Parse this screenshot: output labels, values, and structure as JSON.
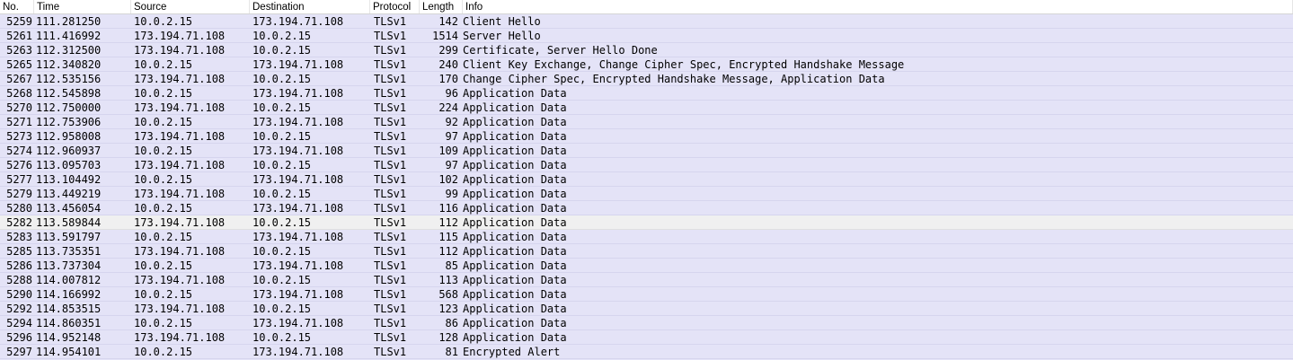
{
  "columns": {
    "no": "No.",
    "time": "Time",
    "source": "Source",
    "destination": "Destination",
    "protocol": "Protocol",
    "length": "Length",
    "info": "Info"
  },
  "packets": [
    {
      "no": "5259",
      "time": "111.281250",
      "source": "10.0.2.15",
      "destination": "173.194.71.108",
      "protocol": "TLSv1",
      "length": "142",
      "info": "Client Hello"
    },
    {
      "no": "5261",
      "time": "111.416992",
      "source": "173.194.71.108",
      "destination": "10.0.2.15",
      "protocol": "TLSv1",
      "length": "1514",
      "info": "Server Hello"
    },
    {
      "no": "5263",
      "time": "112.312500",
      "source": "173.194.71.108",
      "destination": "10.0.2.15",
      "protocol": "TLSv1",
      "length": "299",
      "info": "Certificate, Server Hello Done"
    },
    {
      "no": "5265",
      "time": "112.340820",
      "source": "10.0.2.15",
      "destination": "173.194.71.108",
      "protocol": "TLSv1",
      "length": "240",
      "info": "Client Key Exchange, Change Cipher Spec, Encrypted Handshake Message"
    },
    {
      "no": "5267",
      "time": "112.535156",
      "source": "173.194.71.108",
      "destination": "10.0.2.15",
      "protocol": "TLSv1",
      "length": "170",
      "info": "Change Cipher Spec, Encrypted Handshake Message, Application Data"
    },
    {
      "no": "5268",
      "time": "112.545898",
      "source": "10.0.2.15",
      "destination": "173.194.71.108",
      "protocol": "TLSv1",
      "length": "96",
      "info": "Application Data"
    },
    {
      "no": "5270",
      "time": "112.750000",
      "source": "173.194.71.108",
      "destination": "10.0.2.15",
      "protocol": "TLSv1",
      "length": "224",
      "info": "Application Data"
    },
    {
      "no": "5271",
      "time": "112.753906",
      "source": "10.0.2.15",
      "destination": "173.194.71.108",
      "protocol": "TLSv1",
      "length": "92",
      "info": "Application Data"
    },
    {
      "no": "5273",
      "time": "112.958008",
      "source": "173.194.71.108",
      "destination": "10.0.2.15",
      "protocol": "TLSv1",
      "length": "97",
      "info": "Application Data"
    },
    {
      "no": "5274",
      "time": "112.960937",
      "source": "10.0.2.15",
      "destination": "173.194.71.108",
      "protocol": "TLSv1",
      "length": "109",
      "info": "Application Data"
    },
    {
      "no": "5276",
      "time": "113.095703",
      "source": "173.194.71.108",
      "destination": "10.0.2.15",
      "protocol": "TLSv1",
      "length": "97",
      "info": "Application Data"
    },
    {
      "no": "5277",
      "time": "113.104492",
      "source": "10.0.2.15",
      "destination": "173.194.71.108",
      "protocol": "TLSv1",
      "length": "102",
      "info": "Application Data"
    },
    {
      "no": "5279",
      "time": "113.449219",
      "source": "173.194.71.108",
      "destination": "10.0.2.15",
      "protocol": "TLSv1",
      "length": "99",
      "info": "Application Data"
    },
    {
      "no": "5280",
      "time": "113.456054",
      "source": "10.0.2.15",
      "destination": "173.194.71.108",
      "protocol": "TLSv1",
      "length": "116",
      "info": "Application Data"
    },
    {
      "no": "5282",
      "time": "113.589844",
      "source": "173.194.71.108",
      "destination": "10.0.2.15",
      "protocol": "TLSv1",
      "length": "112",
      "info": "Application Data",
      "highlight": true
    },
    {
      "no": "5283",
      "time": "113.591797",
      "source": "10.0.2.15",
      "destination": "173.194.71.108",
      "protocol": "TLSv1",
      "length": "115",
      "info": "Application Data"
    },
    {
      "no": "5285",
      "time": "113.735351",
      "source": "173.194.71.108",
      "destination": "10.0.2.15",
      "protocol": "TLSv1",
      "length": "112",
      "info": "Application Data"
    },
    {
      "no": "5286",
      "time": "113.737304",
      "source": "10.0.2.15",
      "destination": "173.194.71.108",
      "protocol": "TLSv1",
      "length": "85",
      "info": "Application Data"
    },
    {
      "no": "5288",
      "time": "114.007812",
      "source": "173.194.71.108",
      "destination": "10.0.2.15",
      "protocol": "TLSv1",
      "length": "113",
      "info": "Application Data"
    },
    {
      "no": "5290",
      "time": "114.166992",
      "source": "10.0.2.15",
      "destination": "173.194.71.108",
      "protocol": "TLSv1",
      "length": "568",
      "info": "Application Data"
    },
    {
      "no": "5292",
      "time": "114.853515",
      "source": "173.194.71.108",
      "destination": "10.0.2.15",
      "protocol": "TLSv1",
      "length": "123",
      "info": "Application Data"
    },
    {
      "no": "5294",
      "time": "114.860351",
      "source": "10.0.2.15",
      "destination": "173.194.71.108",
      "protocol": "TLSv1",
      "length": "86",
      "info": "Application Data"
    },
    {
      "no": "5296",
      "time": "114.952148",
      "source": "173.194.71.108",
      "destination": "10.0.2.15",
      "protocol": "TLSv1",
      "length": "128",
      "info": "Application Data"
    },
    {
      "no": "5297",
      "time": "114.954101",
      "source": "10.0.2.15",
      "destination": "173.194.71.108",
      "protocol": "TLSv1",
      "length": "81",
      "info": "Encrypted Alert"
    }
  ],
  "colors": {
    "row_background": "#e4e3f7",
    "highlight_row_background": "#f0f0f0",
    "header_background": "#ffffff"
  }
}
